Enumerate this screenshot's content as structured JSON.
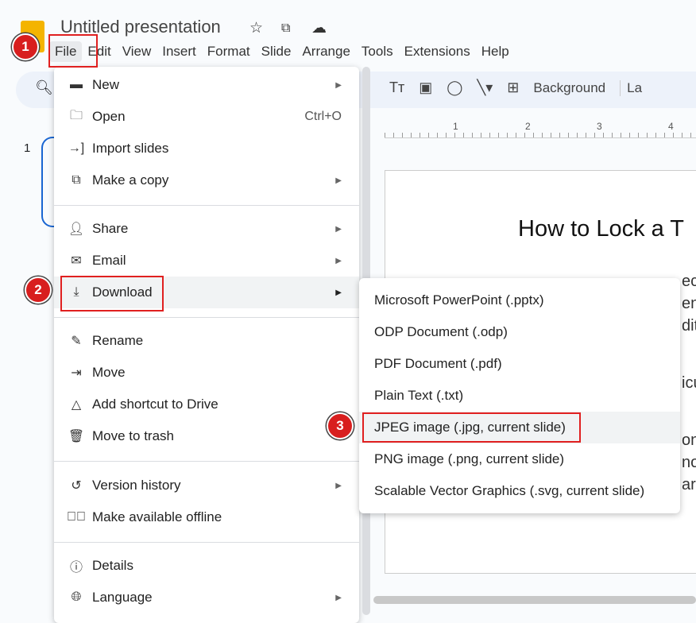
{
  "app": {
    "title": "Untitled presentation",
    "title_icons": [
      "star-icon",
      "move-to-folder-icon",
      "cloud-saved-icon"
    ]
  },
  "menubar": [
    "File",
    "Edit",
    "View",
    "Insert",
    "Format",
    "Slide",
    "Arrange",
    "Tools",
    "Extensions",
    "Help"
  ],
  "toolbar": {
    "background_label": "Background",
    "layout_label_partial": "La"
  },
  "ruler": [
    "1",
    "2",
    "3",
    "4"
  ],
  "thumbnail": {
    "number": "1"
  },
  "slide": {
    "title": "How to Lock a T",
    "fragments": [
      "ec",
      "en",
      "dit",
      "icu",
      "on",
      "no",
      "ar"
    ]
  },
  "file_menu": [
    {
      "label": "New",
      "icon": "new-icon",
      "submenu": true
    },
    {
      "label": "Open",
      "icon": "folder-icon",
      "shortcut": "Ctrl+O"
    },
    {
      "label": "Import slides",
      "icon": "import-icon"
    },
    {
      "label": "Make a copy",
      "icon": "copy-icon",
      "submenu": true
    },
    {
      "label": "Share",
      "icon": "share-person-icon",
      "submenu": true
    },
    {
      "label": "Email",
      "icon": "email-icon",
      "submenu": true
    },
    {
      "label": "Download",
      "icon": "download-icon",
      "submenu": true
    },
    {
      "label": "Rename",
      "icon": "rename-icon"
    },
    {
      "label": "Move",
      "icon": "move-icon"
    },
    {
      "label": "Add shortcut to Drive",
      "icon": "drive-shortcut-icon"
    },
    {
      "label": "Move to trash",
      "icon": "trash-icon"
    },
    {
      "label": "Version history",
      "icon": "history-icon",
      "submenu": true
    },
    {
      "label": "Make available offline",
      "icon": "offline-icon"
    },
    {
      "label": "Details",
      "icon": "info-icon"
    },
    {
      "label": "Language",
      "icon": "globe-icon",
      "submenu": true
    }
  ],
  "download_submenu": [
    "Microsoft PowerPoint (.pptx)",
    "ODP Document (.odp)",
    "PDF Document (.pdf)",
    "Plain Text (.txt)",
    "JPEG image (.jpg, current slide)",
    "PNG image (.png, current slide)",
    "Scalable Vector Graphics (.svg, current slide)"
  ],
  "steps": [
    "1",
    "2",
    "3"
  ],
  "colors": {
    "highlight": "#e02020",
    "badge": "#d81e1e",
    "accent": "#1a66d2"
  }
}
